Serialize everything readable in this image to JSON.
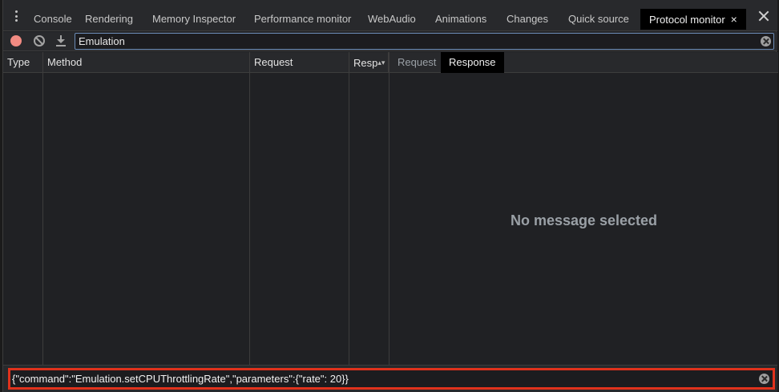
{
  "tabs": [
    {
      "label": "Console"
    },
    {
      "label": "Rendering"
    },
    {
      "label": "Memory Inspector"
    },
    {
      "label": "Performance monitor"
    },
    {
      "label": "WebAudio"
    },
    {
      "label": "Animations"
    },
    {
      "label": "Changes"
    },
    {
      "label": "Quick source"
    },
    {
      "label": "Protocol monitor"
    }
  ],
  "toolbar": {
    "filter_value": "Emulation",
    "icons": [
      "record-icon",
      "clear-icon",
      "save-icon",
      "clear-filter-icon"
    ]
  },
  "table": {
    "columns": [
      "Type",
      "Method",
      "Request",
      "Resp"
    ]
  },
  "detail": {
    "tabs": [
      "Request",
      "Response"
    ],
    "active_tab": "Response",
    "empty_message": "No message selected"
  },
  "command": {
    "value": "{\"command\":\"Emulation.setCPUThrottlingRate\",\"parameters\":{\"rate\": 20}}"
  },
  "colors": {
    "record": "#f28b82",
    "highlight_border": "#e0321c",
    "active_tab_bg": "#000000"
  }
}
